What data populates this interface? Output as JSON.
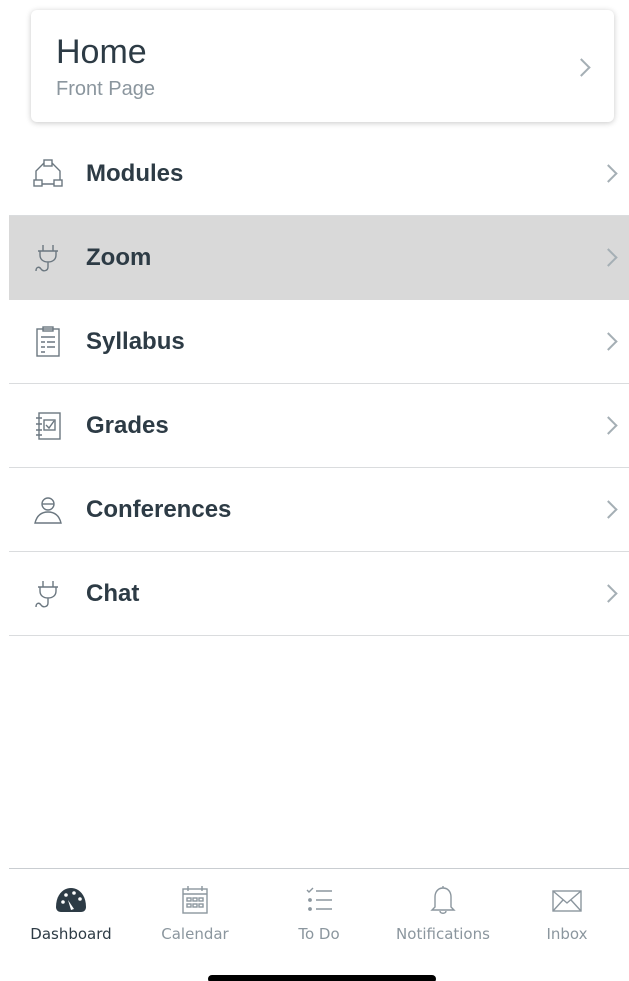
{
  "home_card": {
    "title": "Home",
    "subtitle": "Front Page"
  },
  "menu_items": [
    {
      "label": "Modules",
      "icon": "modules-icon"
    },
    {
      "label": "Zoom",
      "icon": "plug-icon",
      "highlighted": true
    },
    {
      "label": "Syllabus",
      "icon": "syllabus-icon"
    },
    {
      "label": "Grades",
      "icon": "grades-icon"
    },
    {
      "label": "Conferences",
      "icon": "conferences-icon"
    },
    {
      "label": "Chat",
      "icon": "plug-icon"
    }
  ],
  "tabbar": [
    {
      "label": "Dashboard",
      "icon": "dashboard-icon",
      "active": true
    },
    {
      "label": "Calendar",
      "icon": "calendar-icon"
    },
    {
      "label": "To Do",
      "icon": "todo-icon"
    },
    {
      "label": "Notifications",
      "icon": "bell-icon"
    },
    {
      "label": "Inbox",
      "icon": "inbox-icon"
    }
  ],
  "colors": {
    "text": "#2d3b45",
    "muted": "#8b969e",
    "highlight": "#d9d9d9"
  }
}
